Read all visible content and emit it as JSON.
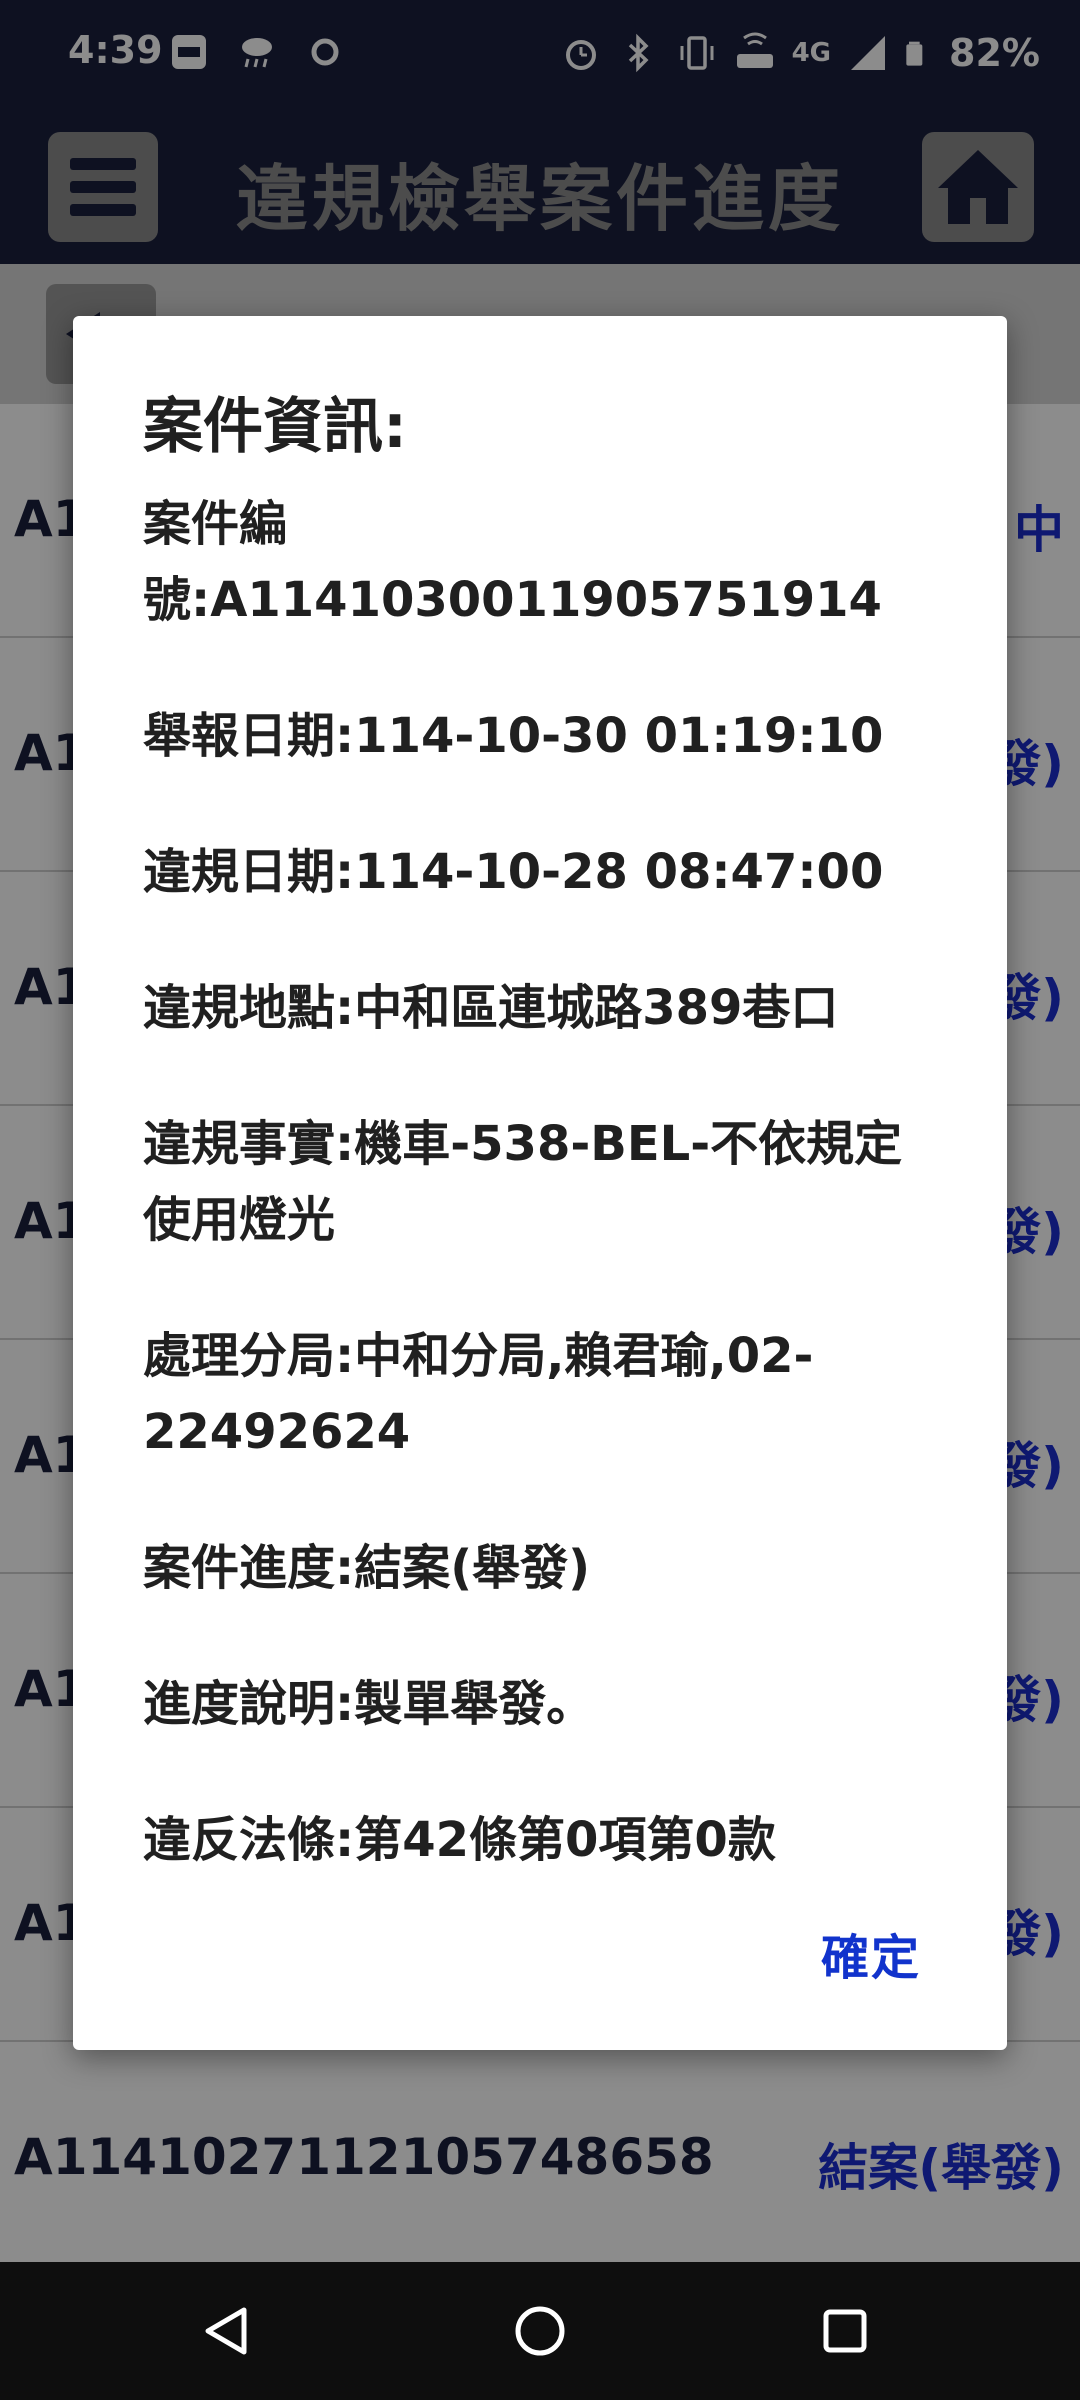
{
  "status_bar": {
    "time": "4:39",
    "network": "4G",
    "battery": "82%",
    "left_icons": [
      "sim-card-icon",
      "cloud-rain-icon",
      "circle-icon"
    ],
    "right_icons": [
      "alarm-icon",
      "bluetooth-icon",
      "vibrate-icon",
      "volte-icon",
      "signal-icon",
      "battery-icon"
    ]
  },
  "header": {
    "title": "違規檢舉案件進度",
    "menu_icon": "hamburger-menu-icon",
    "home_icon": "home-icon"
  },
  "background_list": {
    "rows": [
      {
        "id": "A1",
        "status": "中"
      },
      {
        "id": "A1",
        "status": "發)"
      },
      {
        "id": "A1",
        "status": "發)"
      },
      {
        "id": "A1",
        "status": "發)"
      },
      {
        "id": "A1",
        "status": "發)"
      },
      {
        "id": "A1",
        "status": "發)"
      },
      {
        "id": "A1",
        "status": "發)"
      },
      {
        "id": "A114102711210574865​8",
        "status": "結案(舉發)"
      }
    ]
  },
  "dialog": {
    "title": "案件資訊:",
    "fields": [
      {
        "label": "案件編號",
        "value": "A114103001190575191​4"
      },
      {
        "label": "舉報日期",
        "value": "114-10-30 01:19:10"
      },
      {
        "label": "違規日期",
        "value": "114-10-28 08:47:00"
      },
      {
        "label": "違規地點",
        "value": "中和區連城路389巷口"
      },
      {
        "label": "違規事實",
        "value": "機車-538-BEL-不依規定使用燈光"
      },
      {
        "label": "處理分局",
        "value": "中和分局,賴君瑜,02-22492624"
      },
      {
        "label": "案件進度",
        "value": "結案(舉發)"
      },
      {
        "label": "進度說明",
        "value": "製單舉發。"
      },
      {
        "label": "違反法條",
        "value": "第42條第0項第0款"
      }
    ],
    "confirm_label": "確定"
  },
  "nav_bar": {
    "icons": [
      "back-icon",
      "home-circle-icon",
      "recents-icon"
    ]
  },
  "colors": {
    "header_bg": "#1a1f3d",
    "accent_blue": "#1133cc",
    "status_blue": "#1c2fd0"
  }
}
